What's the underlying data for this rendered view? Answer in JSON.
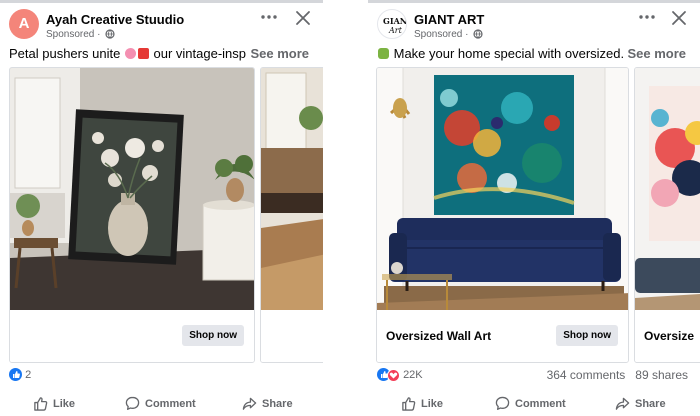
{
  "left_post": {
    "page_name": "Ayah Creative Stuudio",
    "avatar_letter": "A",
    "sponsored": "Sponsored · ",
    "caption": "Petal pushers unite ",
    "caption_tail": " our vintage-insp...",
    "see_more": "See more",
    "card": {
      "cta": "Shop now"
    },
    "reaction_count": "2",
    "actions": {
      "like": "Like",
      "comment": "Comment",
      "share": "Share"
    },
    "icons": [
      "more-options-icon",
      "close-icon",
      "globe-icon",
      "like-reaction-icon",
      "like-icon",
      "comment-icon",
      "share-icon"
    ]
  },
  "right_post": {
    "page_name": "GIANT ART",
    "avatar_text": "GIANT ART",
    "sponsored": "Sponsored · ",
    "caption": "Make your home special with oversized...",
    "see_more": "See more",
    "card1": {
      "title": "Oversized Wall Art",
      "cta": "Shop now"
    },
    "card2": {
      "title": "Oversize"
    },
    "reaction_count": "22K",
    "comments": "364 comments",
    "shares": "89 shares",
    "actions": {
      "like": "Like",
      "comment": "Comment",
      "share": "Share"
    },
    "colors": {
      "sofa": "#1e2d5c",
      "like_blue": "#1877f2",
      "love_red": "#f33e58"
    }
  }
}
